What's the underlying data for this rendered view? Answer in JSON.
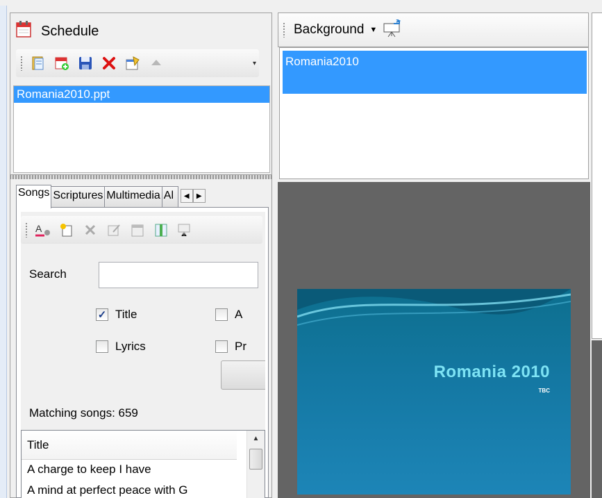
{
  "schedule": {
    "title": "Schedule",
    "items": [
      "Romania2010.ppt"
    ]
  },
  "songs_tabs": {
    "tabs": [
      "Songs",
      "Scriptures",
      "Multimedia",
      "Al"
    ]
  },
  "songs": {
    "search_label": "Search",
    "search_value": "",
    "options": {
      "title": {
        "label": "Title",
        "checked": true
      },
      "author": {
        "label": "A",
        "checked": false
      },
      "lyrics": {
        "label": "Lyrics",
        "checked": false
      },
      "presentation": {
        "label": "Pr",
        "checked": false
      }
    },
    "matching": "Matching songs: 659",
    "column_header": "Title",
    "rows": [
      "A charge to keep I have",
      "A mind at perfect peace with G"
    ]
  },
  "background": {
    "dropdown_label": "Background",
    "items": [
      "Romania2010"
    ]
  },
  "slide": {
    "title": "Romania 2010",
    "subtitle": "TBC"
  },
  "colors": {
    "selection": "#3399ff",
    "preview_bg": "#646464",
    "slide_title": "#7de3f4"
  }
}
